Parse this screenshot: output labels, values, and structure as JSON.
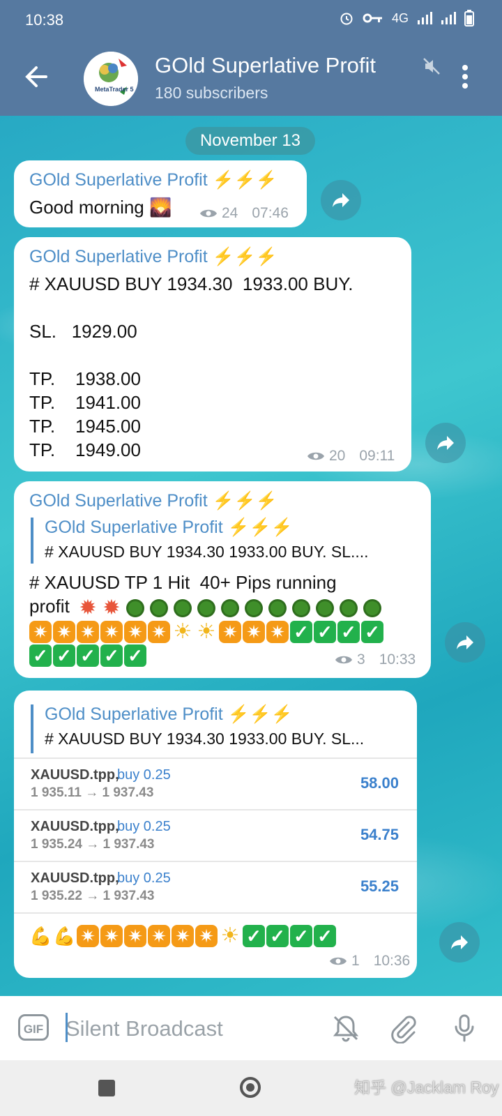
{
  "status_bar": {
    "time": "10:38",
    "network": "4G"
  },
  "header": {
    "channel_title": "GOld Superlative Profit",
    "subscribers": "180 subscribers",
    "avatar_text": "MetaTrader 5"
  },
  "chat": {
    "date_chip": "November 13",
    "messages": [
      {
        "sender": "GOld Superlative Profit ⚡⚡⚡",
        "text": "Good morning 🌄",
        "views": "24",
        "time": "07:46"
      },
      {
        "sender": "GOld Superlative Profit ⚡⚡⚡",
        "text": "# XAUUSD BUY 1934.30  1933.00 BUY.\n\nSL.   1929.00\n\nTP.    1938.00\nTP.    1941.00\nTP.    1945.00\nTP.    1949.00",
        "views": "20",
        "time": "09:11"
      },
      {
        "sender": "GOld Superlative Profit ⚡⚡⚡",
        "reply_name": "GOld Superlative Profit ⚡⚡⚡",
        "reply_text": "# XAUUSD BUY 1934.30  1933.00 BUY.   SL....",
        "text": "# XAUUSD TP 1 Hit  40+ Pips running\nprofit",
        "views": "3",
        "time": "10:33"
      },
      {
        "reply_name": "GOld Superlative Profit ⚡⚡⚡",
        "reply_text": "# XAUUSD BUY 1934.30  1933.00 BUY.   SL...",
        "trades": [
          {
            "symbol": "XAUUSD.tpp,",
            "side": "buy 0.25",
            "prices": "1 935.11 → 1 937.43",
            "profit": "58.00"
          },
          {
            "symbol": "XAUUSD.tpp,",
            "side": "buy 0.25",
            "prices": "1 935.24 → 1 937.43",
            "profit": "54.75"
          },
          {
            "symbol": "XAUUSD.tpp,",
            "side": "buy 0.25",
            "prices": "1 935.22 → 1 937.43",
            "profit": "55.25"
          }
        ],
        "views": "1",
        "time": "10:36"
      }
    ]
  },
  "input_bar": {
    "gif_label": "GIF",
    "placeholder": "Silent Broadcast"
  },
  "watermark": "知乎 @Jacklam Roy",
  "colors": {
    "header": "#5679a0",
    "accent": "#4e8ec7",
    "bubble": "#ffffff"
  }
}
